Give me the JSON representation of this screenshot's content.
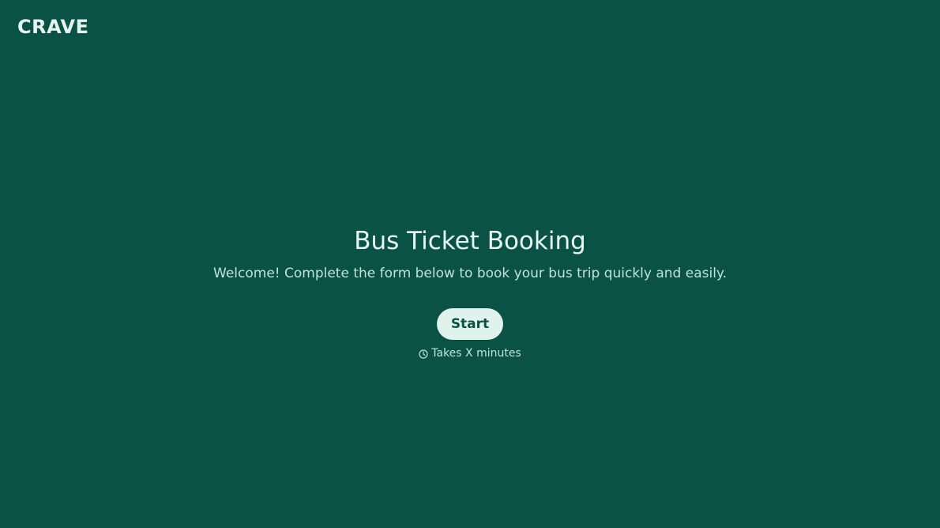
{
  "brand": {
    "logo_text": "CRAVE"
  },
  "hero": {
    "title": "Bus Ticket Booking",
    "subtitle": "Welcome! Complete the form below to book your bus trip quickly and easily.",
    "start_label": "Start",
    "duration_text": "Takes X minutes",
    "duration_icon": "clock-icon"
  },
  "colors": {
    "background": "#0a5245",
    "button_bg": "#dff2ec",
    "text_primary": "#e8f6f1",
    "text_secondary": "#bfe3d8"
  }
}
